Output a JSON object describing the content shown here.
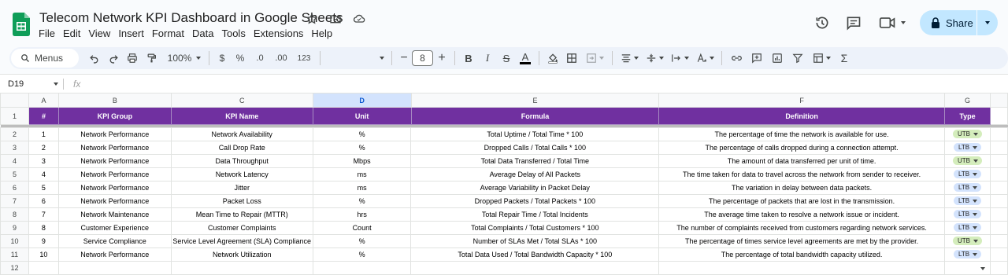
{
  "doc": {
    "title": "Telecom Network KPI Dashboard in Google Sheets",
    "menu": [
      "File",
      "Edit",
      "View",
      "Insert",
      "Format",
      "Data",
      "Tools",
      "Extensions",
      "Help"
    ],
    "share_label": "Share"
  },
  "toolbar": {
    "menus_label": "Menus",
    "zoom": "100%",
    "currency": "$",
    "percent": "%",
    "dec_decrease": ".0",
    "dec_increase": ".00",
    "number_format": "123",
    "font_size": "8"
  },
  "formula_bar": {
    "cell_ref": "D19",
    "fx": "fx",
    "content": ""
  },
  "columns": [
    "A",
    "B",
    "C",
    "D",
    "E",
    "F",
    "G"
  ],
  "selected_column": "D",
  "headers": [
    "#",
    "KPI Group",
    "KPI Name",
    "Unit",
    "Formula",
    "Definition",
    "Type"
  ],
  "rows": [
    {
      "n": "1",
      "group": "Network Performance",
      "name": "Network Availability",
      "unit": "%",
      "formula": "Total Uptime / Total Time * 100",
      "definition": "The percentage of time the network is available for use.",
      "type": "UTB"
    },
    {
      "n": "2",
      "group": "Network Performance",
      "name": "Call Drop Rate",
      "unit": "%",
      "formula": "Dropped Calls / Total Calls * 100",
      "definition": "The percentage of calls dropped during a connection attempt.",
      "type": "LTB"
    },
    {
      "n": "3",
      "group": "Network Performance",
      "name": "Data Throughput",
      "unit": "Mbps",
      "formula": "Total Data Transferred / Total Time",
      "definition": "The amount of data transferred per unit of time.",
      "type": "UTB"
    },
    {
      "n": "4",
      "group": "Network Performance",
      "name": "Network Latency",
      "unit": "ms",
      "formula": "Average Delay of All Packets",
      "definition": "The time taken for data to travel across the network from sender to receiver.",
      "type": "LTB"
    },
    {
      "n": "5",
      "group": "Network Performance",
      "name": "Jitter",
      "unit": "ms",
      "formula": "Average Variability in Packet Delay",
      "definition": "The variation in delay between data packets.",
      "type": "LTB"
    },
    {
      "n": "6",
      "group": "Network Performance",
      "name": "Packet Loss",
      "unit": "%",
      "formula": "Dropped Packets / Total Packets * 100",
      "definition": "The percentage of packets that are lost in the transmission.",
      "type": "LTB"
    },
    {
      "n": "7",
      "group": "Network Maintenance",
      "name": "Mean Time to Repair (MTTR)",
      "unit": "hrs",
      "formula": "Total Repair Time / Total Incidents",
      "definition": "The average time taken to resolve a network issue or incident.",
      "type": "LTB"
    },
    {
      "n": "8",
      "group": "Customer Experience",
      "name": "Customer Complaints",
      "unit": "Count",
      "formula": "Total Complaints / Total Customers * 100",
      "definition": "The number of complaints received from customers regarding network services.",
      "type": "LTB"
    },
    {
      "n": "9",
      "group": "Service Compliance",
      "name": "Service Level Agreement (SLA) Compliance",
      "unit": "%",
      "formula": "Number of SLAs Met / Total SLAs * 100",
      "definition": "The percentage of times service level agreements are met by the provider.",
      "type": "UTB"
    },
    {
      "n": "10",
      "group": "Network Performance",
      "name": "Network Utilization",
      "unit": "%",
      "formula": "Total Data Used / Total Bandwidth Capacity * 100",
      "definition": "The percentage of total bandwidth capacity utilized.",
      "type": "LTB"
    }
  ],
  "row_numbers": [
    "1",
    "2",
    "3",
    "4",
    "5",
    "6",
    "7",
    "8",
    "9",
    "10",
    "11",
    "12"
  ],
  "colors": {
    "header_bg": "#7030a0",
    "utb_chip": "#d4edbc",
    "ltb_chip": "#d3e3fd",
    "share_bg": "#c2e7ff"
  }
}
